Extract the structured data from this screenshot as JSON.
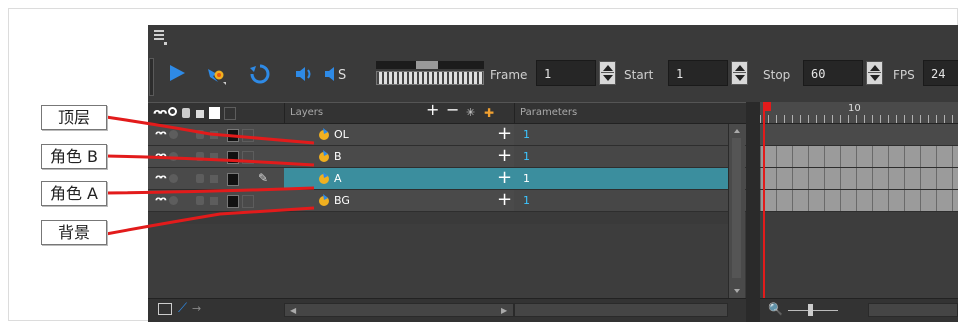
{
  "toolbar": {
    "frame_label": "Frame",
    "frame_value": "1",
    "start_label": "Start",
    "start_value": "1",
    "stop_label": "Stop",
    "stop_value": "60",
    "fps_label": "FPS",
    "fps_value": "24"
  },
  "header": {
    "layers_label": "Layers",
    "parameters_label": "Parameters"
  },
  "layers": [
    {
      "name": "OL",
      "param": "1"
    },
    {
      "name": "B",
      "param": "1"
    },
    {
      "name": "A",
      "param": "1"
    },
    {
      "name": "BG",
      "param": "1"
    }
  ],
  "selected_layer": "A",
  "timeline": {
    "ruler_label": "10"
  },
  "callouts": [
    {
      "label": "顶层"
    },
    {
      "label": "角色 B"
    },
    {
      "label": "角色 A"
    },
    {
      "label": "背景"
    }
  ],
  "colors": {
    "accent_play": "#2e8ae6",
    "selection": "#3b8e9e",
    "param_value": "#3cc5ff",
    "playhead": "#e21b1b",
    "callout_line": "#e21b1b"
  }
}
